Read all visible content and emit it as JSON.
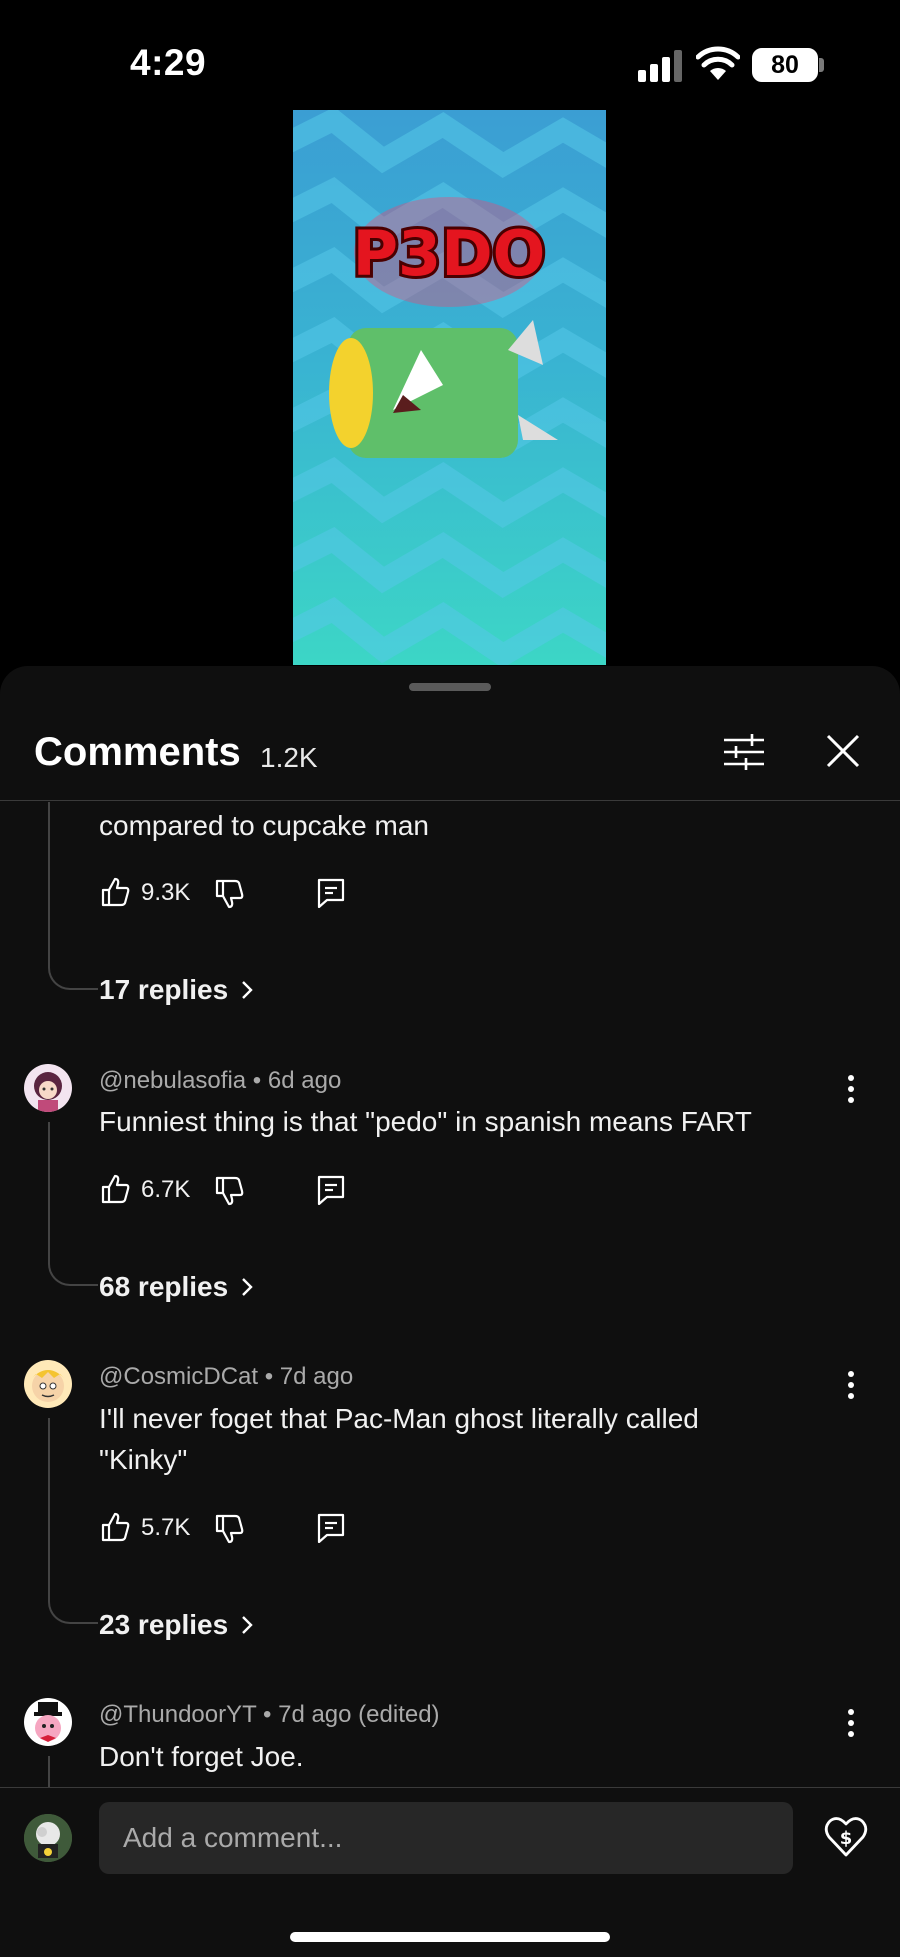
{
  "status_bar": {
    "time": "4:29",
    "battery": "80"
  },
  "video": {
    "overlay_title": "P3DO"
  },
  "comments_panel": {
    "title": "Comments",
    "count": "1.2K"
  },
  "comments": [
    {
      "text": "compared to cupcake man",
      "likes": "9.3K",
      "replies_label": "17 replies"
    },
    {
      "author": "@nebulasofia",
      "age": "6d ago",
      "text": "Funniest thing is that \"pedo\" in spanish means FART",
      "likes": "6.7K",
      "replies_label": "68 replies"
    },
    {
      "author": "@CosmicDCat",
      "age": "7d ago",
      "text_line1": "I'll never foget that Pac-Man ghost literally called",
      "text_line2": "\"Kinky\"",
      "likes": "5.7K",
      "replies_label": "23 replies"
    },
    {
      "author": "@ThundoorYT",
      "age": "7d ago (edited)",
      "text": "Don't forget Joe."
    }
  ],
  "composer": {
    "placeholder": "Add a comment..."
  },
  "colors": {
    "background": "#0f0f0f",
    "input_bg": "#272727",
    "secondary_text": "#aaaaaa"
  }
}
